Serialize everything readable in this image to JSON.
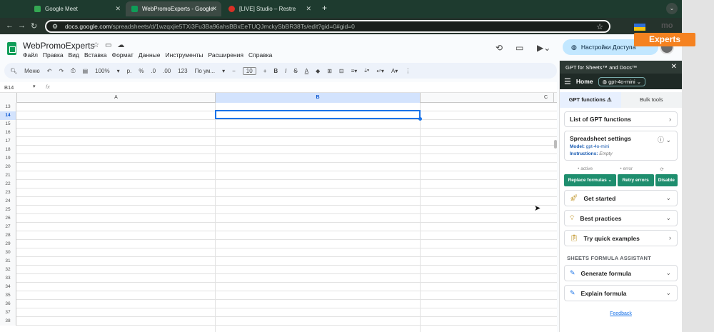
{
  "browser": {
    "tabs": [
      {
        "title": "Google Meet",
        "color": "#34a853"
      },
      {
        "title": "WebPromoExperts - Google S",
        "color": "#0f9d58"
      },
      {
        "title": "[LIVE] Studio – Restre",
        "color": "#d93025"
      }
    ],
    "url_host": "docs.google.com",
    "url_path": "/spreadsheets/d/1wzqxjie5TXi3Fu3Ba96ahsBBxEeTUQJmckySbBR38Ts/edit?gid=0#gid=0"
  },
  "sheet": {
    "title": "WebPromoExperts",
    "menu": [
      "Файл",
      "Правка",
      "Вид",
      "Вставка",
      "Формат",
      "Данные",
      "Инструменты",
      "Расширения",
      "Справка"
    ],
    "share_label": "Настройки Доступа",
    "toolbar": {
      "search": "Меню",
      "zoom": "100%",
      "currency": "р.",
      "percent": "%",
      "dec_minus": ".0",
      "dec_plus": ".00",
      "num123": "123",
      "font": "По ум...",
      "font_size": "10"
    },
    "namebox": "B14",
    "fx": "fx",
    "columns": [
      "A",
      "B",
      "C"
    ],
    "rows": [
      "13",
      "14",
      "15",
      "16",
      "17",
      "18",
      "19",
      "20",
      "21",
      "22",
      "23",
      "24",
      "25",
      "26",
      "27",
      "28",
      "29",
      "30",
      "31",
      "32",
      "33",
      "34",
      "35",
      "36",
      "37",
      "38"
    ]
  },
  "sidebar": {
    "header": "GPT for Sheets™ and Docs™",
    "nav_home": "Home",
    "model": "gpt-4o-mini",
    "tab_functions": "GPT functions",
    "tab_bulk": "Bulk tools",
    "list_functions": "List of GPT functions",
    "settings_title": "Spreadsheet settings",
    "settings_model_label": "Model:",
    "settings_model_value": "gpt-4o-mini",
    "settings_instr_label": "Instructions:",
    "settings_instr_value": "Empty",
    "status_active": "• active",
    "status_error": "• error",
    "btn_replace": "Replace formulas ⌄",
    "btn_retry": "Retry errors",
    "btn_disable": "Disable",
    "get_started": "Get started",
    "best_practices": "Best practices",
    "quick_examples": "Try quick examples",
    "formula_section": "SHEETS FORMULA ASSISTANT",
    "generate_formula": "Generate formula",
    "explain_formula": "Explain formula",
    "feedback": "Feedback"
  },
  "watermark": {
    "text": "mo",
    "brand": "Experts"
  }
}
